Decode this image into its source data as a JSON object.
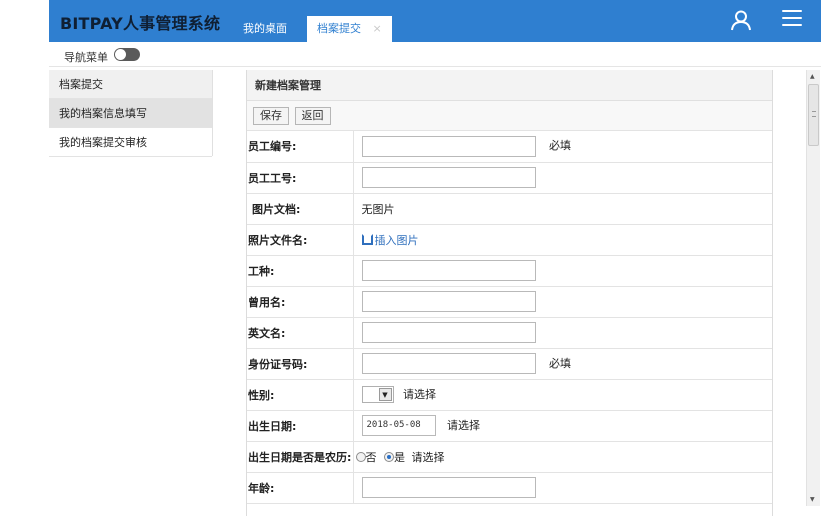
{
  "header": {
    "title": "BITPAY人事管理系统",
    "tabs": [
      {
        "label": "我的桌面"
      },
      {
        "label": "档案提交",
        "close": "×"
      }
    ],
    "user_icon": "user-icon",
    "menu_icon": "hamburger-menu-icon"
  },
  "navbar": {
    "label": "导航菜单"
  },
  "sidebar": {
    "items": [
      {
        "label": "档案提交"
      },
      {
        "label": "我的档案信息填写"
      },
      {
        "label": "我的档案提交审核"
      }
    ]
  },
  "panel": {
    "title": "新建档案管理",
    "buttons": {
      "save": "保存",
      "back": "返回"
    },
    "fields": {
      "employee_no": {
        "label": "员工编号:",
        "value": "",
        "required": "必填"
      },
      "work_no": {
        "label": "员工工号:",
        "value": ""
      },
      "photo_doc": {
        "label": "图片文档:",
        "value": "无图片"
      },
      "photo_file": {
        "label": "照片文件名:",
        "link": "插入图片"
      },
      "job_type": {
        "label": "工种:",
        "value": ""
      },
      "former_name": {
        "label": "曾用名:",
        "value": ""
      },
      "english_name": {
        "label": "英文名:",
        "value": ""
      },
      "id_number": {
        "label": "身份证号码:",
        "value": "",
        "required": "必填"
      },
      "gender": {
        "label": "性别:",
        "hint": "请选择"
      },
      "birth_date": {
        "label": "出生日期:",
        "value": "2018-05-08",
        "hint": "请选择"
      },
      "lunar": {
        "label": "出生日期是否是农历:",
        "option_no": "否",
        "option_yes": "是",
        "hint": "请选择",
        "selected": "是"
      },
      "age": {
        "label": "年龄:",
        "value": ""
      }
    }
  },
  "colors": {
    "header_bg": "#2f7fd0",
    "accent": "#2f7fd0",
    "link": "#2f6fbd"
  }
}
